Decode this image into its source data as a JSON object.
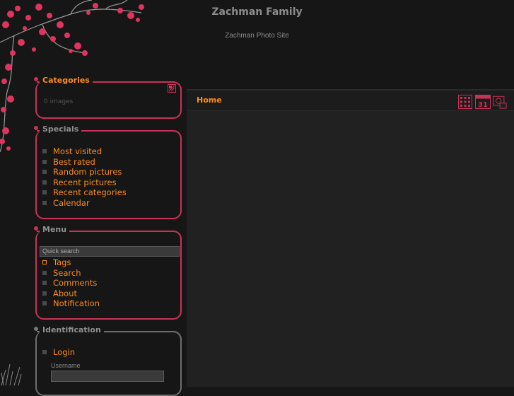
{
  "site": {
    "title": "Zachman Family",
    "subtitle": "Zachman Photo Site"
  },
  "colors": {
    "accent": "#ff8c1a",
    "frame": "#c93256",
    "background": "#161616"
  },
  "categories": {
    "title": "Categories",
    "count": "0 images",
    "icon": "category-toggle-icon"
  },
  "specials": {
    "title": "Specials",
    "items": [
      {
        "label": "Most visited"
      },
      {
        "label": "Best rated"
      },
      {
        "label": "Random pictures"
      },
      {
        "label": "Recent pictures"
      },
      {
        "label": "Recent categories"
      },
      {
        "label": "Calendar"
      }
    ]
  },
  "menu": {
    "title": "Menu",
    "search_placeholder": "Quick search",
    "items": [
      {
        "label": "Tags"
      },
      {
        "label": "Search"
      },
      {
        "label": "Comments"
      },
      {
        "label": "About"
      },
      {
        "label": "Notification"
      }
    ]
  },
  "identification": {
    "title": "Identification",
    "login": "Login",
    "username_label": "Username"
  },
  "main": {
    "breadcrumb": "Home",
    "icons": [
      "thumbnails-grid-icon",
      "calendar-icon",
      "slideshow-icon"
    ],
    "calendar_day": "31"
  }
}
